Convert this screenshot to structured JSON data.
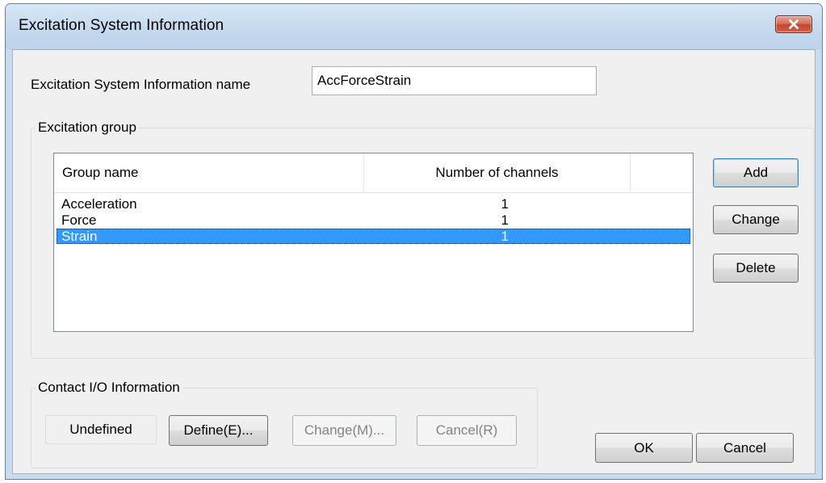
{
  "window": {
    "title": "Excitation System Information",
    "close_icon": "close-icon"
  },
  "name_field": {
    "label": "Excitation System Information name",
    "value": "AccForceStrain"
  },
  "excitation_group": {
    "title": "Excitation group",
    "columns": [
      "Group name",
      "Number of channels"
    ],
    "rows": [
      {
        "name": "Acceleration",
        "channels": "1",
        "selected": false
      },
      {
        "name": "Force",
        "channels": "1",
        "selected": false
      },
      {
        "name": "Strain",
        "channels": "1",
        "selected": true
      }
    ],
    "buttons": {
      "add": "Add",
      "change": "Change",
      "delete": "Delete"
    }
  },
  "contact_io": {
    "title": "Contact I/O Information",
    "status": "Undefined",
    "define": "Define(E)...",
    "change": "Change(M)...",
    "cancel": "Cancel(R)"
  },
  "footer": {
    "ok": "OK",
    "cancel": "Cancel"
  },
  "colors": {
    "selection": "#3399ff",
    "title_bar": "#c6d9ee",
    "close_button": "#c4452f"
  }
}
